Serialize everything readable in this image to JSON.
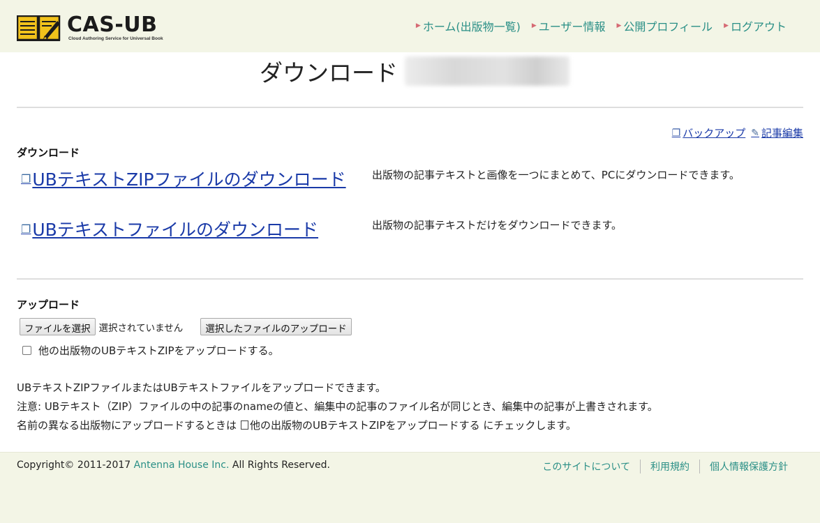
{
  "header": {
    "logo_text": "CAS-UB",
    "logo_sub": "Cloud Authoring Service for Universal Book",
    "nav": [
      {
        "label": "ホーム(出版物一覧)"
      },
      {
        "label": "ユーザー情報"
      },
      {
        "label": "公開プロフィール"
      },
      {
        "label": "ログアウト"
      }
    ],
    "nav_bullet": "▶"
  },
  "page": {
    "title": "ダウンロード"
  },
  "tools": {
    "backup_label": "バックアップ",
    "edit_label": "記事編集"
  },
  "download": {
    "section_title": "ダウンロード",
    "items": [
      {
        "link_label": "UBテキストZIPファイルのダウンロード",
        "description": "出版物の記事テキストと画像を一つにまとめて、PCにダウンロードできます。"
      },
      {
        "link_label": "UBテキストファイルのダウンロード",
        "description": "出版物の記事テキストだけをダウンロードできます。"
      }
    ]
  },
  "upload": {
    "section_title": "アップロード",
    "choose_file_label": "ファイルを選択",
    "no_file_text": "選択されていません",
    "upload_button_label": "選択したファイルのアップロード",
    "checkbox_label": "他の出版物のUBテキストZIPをアップロードする。",
    "checkbox_checked": false
  },
  "notes": {
    "line1": "UBテキストZIPファイルまたはUBテキストファイルをアップロードできます。",
    "line2": "注意: UBテキスト（ZIP）ファイルの中の記事のnameの値と、編集中の記事のファイル名が同じとき、編集中の記事が上書きされます。",
    "line3_pre": "名前の異なる出版物にアップロードするときは",
    "line3_post": "他の出版物のUBテキストZIPをアップロードする にチェックします。"
  },
  "footer": {
    "copyright_pre": "Copyright© 2011-2017 ",
    "company": "Antenna House Inc.",
    "copyright_post": " All Rights Reserved.",
    "links": [
      {
        "label": "このサイトについて"
      },
      {
        "label": "利用規約"
      },
      {
        "label": "個人情報保護方針"
      }
    ]
  },
  "colors": {
    "header_bg": "#f3f5e6",
    "nav_link": "#2a8f86",
    "nav_bullet": "#d66a74",
    "link_blue": "#1a3aa8"
  }
}
